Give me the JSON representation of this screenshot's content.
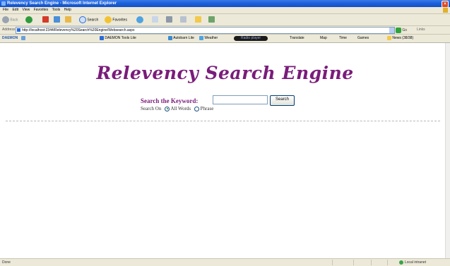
{
  "window": {
    "title": "Relevency Search Engine - Microsoft Internet Explorer",
    "close_glyph": "×"
  },
  "menu": [
    "File",
    "Edit",
    "View",
    "Favorites",
    "Tools",
    "Help"
  ],
  "toolbar": {
    "back_label": "Back",
    "search_label": "Search",
    "favorites_label": "Favorites"
  },
  "address": {
    "label": "Address",
    "url": "http://localhost:2344/Relevency%20Search%20Engine/Websearch.aspx",
    "go_label": "Go",
    "links_label": "Links"
  },
  "daemon_toolbar": {
    "logo": "DAEMON",
    "lite_label": "DAEMON Tools Lite",
    "autobarn_label": "Autobarn Lite",
    "weather_label": "Weather",
    "radio_label": "Radio player",
    "translate_label": "Translate",
    "maps_label": "Map",
    "time_label": "Time",
    "games_label": "Games",
    "news_label": "News (38/38)"
  },
  "page": {
    "title": "Relevency Search Engine",
    "search_label": "Search the Keyword:",
    "search_value": "",
    "search_button": "Search",
    "search_on_label": "Search On",
    "option_all": "All Words",
    "option_phrase": "Phrase",
    "selected_option": "All Words"
  },
  "status": {
    "left": "Done",
    "zone": "Local intranet"
  },
  "colors": {
    "title_purple": "#7a1c7a",
    "xp_blue": "#1a5fd8",
    "chrome": "#ece9d8"
  }
}
